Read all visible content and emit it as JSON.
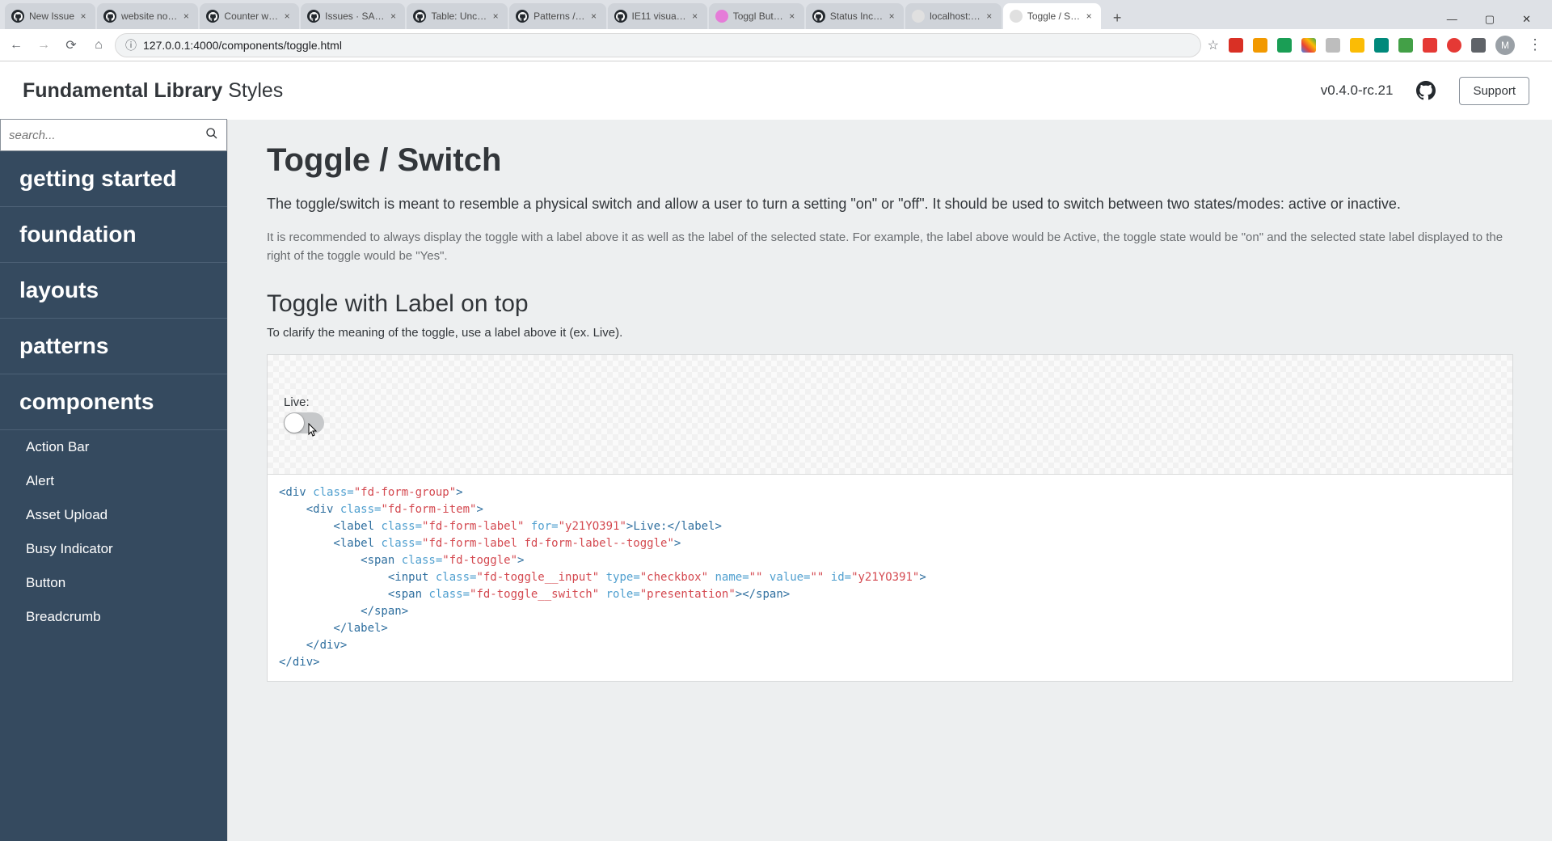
{
  "browser": {
    "tabs": [
      {
        "title": "New Issue",
        "favicon": "github"
      },
      {
        "title": "website no…",
        "favicon": "github"
      },
      {
        "title": "Counter w…",
        "favicon": "github"
      },
      {
        "title": "Issues · SA…",
        "favicon": "github"
      },
      {
        "title": "Table: Unc…",
        "favicon": "github"
      },
      {
        "title": "Patterns /…",
        "favicon": "github"
      },
      {
        "title": "IE11 visua…",
        "favicon": "github"
      },
      {
        "title": "Toggl But…",
        "favicon": "toggl"
      },
      {
        "title": "Status Inc…",
        "favicon": "github"
      },
      {
        "title": "localhost:…",
        "favicon": "blank"
      },
      {
        "title": "Toggle / S…",
        "favicon": "blank",
        "active": true
      }
    ],
    "url": "127.0.0.1:4000/components/toggle.html",
    "avatar_initial": "M"
  },
  "header": {
    "brand_bold": "Fundamental Library",
    "brand_light": "Styles",
    "version": "v0.4.0-rc.21",
    "support": "Support"
  },
  "sidebar": {
    "search_placeholder": "search...",
    "sections": [
      "getting started",
      "foundation",
      "layouts",
      "patterns",
      "components"
    ],
    "components": [
      "Action Bar",
      "Alert",
      "Asset Upload",
      "Busy Indicator",
      "Button",
      "Breadcrumb"
    ]
  },
  "content": {
    "title": "Toggle / Switch",
    "lead": "The toggle/switch is meant to resemble a physical switch and allow a user to turn a setting \"on\" or \"off\". It should be used to switch between two states/modes: active or inactive.",
    "desc": "It is recommended to always display the toggle with a label above it as well as the label of the selected state. For example, the label above would be Active, the toggle state would be \"on\" and the selected state label displayed to the right of the toggle would be \"Yes\".",
    "h2": "Toggle with Label on top",
    "sub": "To clarify the meaning of the toggle, use a label above it (ex. Live).",
    "example_label": "Live:"
  },
  "code": {
    "l1_a": "<div ",
    "l1_b": "class=",
    "l1_c": "\"fd-form-group\"",
    "l1_d": ">",
    "l2_a": "    <div ",
    "l2_b": "class=",
    "l2_c": "\"fd-form-item\"",
    "l2_d": ">",
    "l3_a": "        <label ",
    "l3_b": "class=",
    "l3_c": "\"fd-form-label\"",
    "l3_d": " for=",
    "l3_e": "\"y21YO391\"",
    "l3_f": ">Live:</label>",
    "l4_a": "        <label ",
    "l4_b": "class=",
    "l4_c": "\"fd-form-label fd-form-label--toggle\"",
    "l4_d": ">",
    "l5_a": "            <span ",
    "l5_b": "class=",
    "l5_c": "\"fd-toggle\"",
    "l5_d": ">",
    "l6_a": "                <input ",
    "l6_b": "class=",
    "l6_c": "\"fd-toggle__input\"",
    "l6_d": " type=",
    "l6_e": "\"checkbox\"",
    "l6_f": " name=",
    "l6_g": "\"\"",
    "l6_h": " value=",
    "l6_i": "\"\"",
    "l6_j": " id=",
    "l6_k": "\"y21YO391\"",
    "l6_l": ">",
    "l7_a": "                <span ",
    "l7_b": "class=",
    "l7_c": "\"fd-toggle__switch\"",
    "l7_d": " role=",
    "l7_e": "\"presentation\"",
    "l7_f": "></span>",
    "l8": "            </span>",
    "l9": "        </label>",
    "l10": "    </div>",
    "l11": "</div>"
  }
}
